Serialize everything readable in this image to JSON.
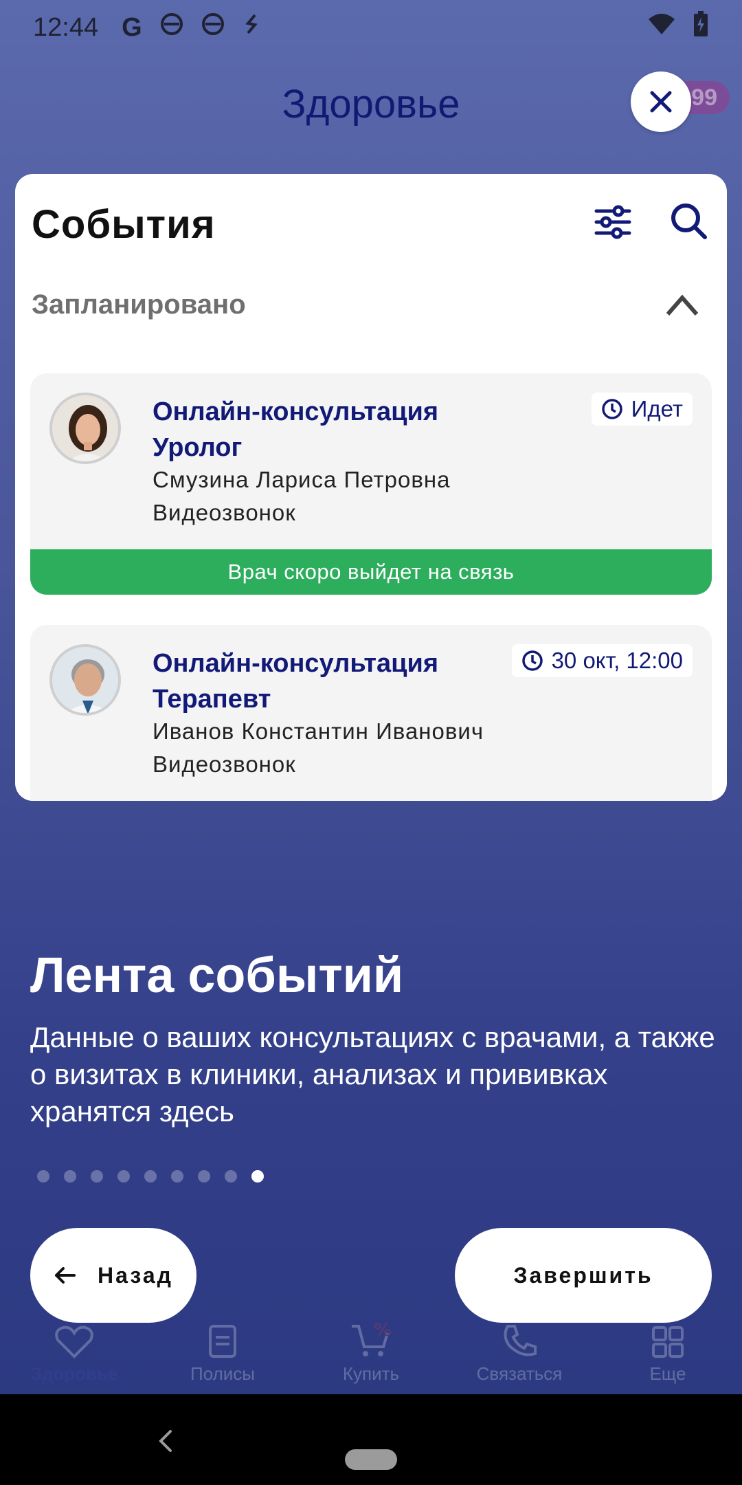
{
  "status_bar": {
    "time": "12:44",
    "left_icons": [
      "google-icon",
      "notification-icon",
      "notification-icon",
      "sync-icon"
    ],
    "right_icons": [
      "wifi-icon",
      "battery-charging-icon"
    ]
  },
  "header": {
    "title": "Здоровье",
    "badge": "99"
  },
  "panel": {
    "title": "События",
    "section_title": "Запланировано",
    "events": [
      {
        "title": "Онлайн-консультация Уролог",
        "doctor": "Смузина Лариса Петровна",
        "type": "Видеозвонок",
        "time": "Идет",
        "status": "Врач скоро выйдет на связь"
      },
      {
        "title": "Онлайн-консультация Терапевт",
        "doctor": "Иванов Константин Иванович",
        "type": "Видеозвонок",
        "time": "30 окт, 12:00"
      }
    ]
  },
  "onboarding": {
    "title": "Лента событий",
    "body": "Данные о ваших консультациях с врачами, а также о визитах в клиники, анализах и прививках хранятся здесь",
    "total_steps": 9,
    "current_step": 9,
    "back_label": "Назад",
    "finish_label": "Завершить"
  },
  "bottom_nav": {
    "items": [
      {
        "label": "Здоровье",
        "icon": "heart-pulse-icon"
      },
      {
        "label": "Полисы",
        "icon": "clipboard-icon"
      },
      {
        "label": "Купить",
        "icon": "cart-percent-icon"
      },
      {
        "label": "Связаться",
        "icon": "phone-icon"
      },
      {
        "label": "Еще",
        "icon": "grid-icon"
      }
    ]
  },
  "colors": {
    "accent": "#121a78",
    "success": "#2dae5d",
    "overlay_top": "#5b69ad",
    "overlay_bottom": "#2c3a82"
  }
}
